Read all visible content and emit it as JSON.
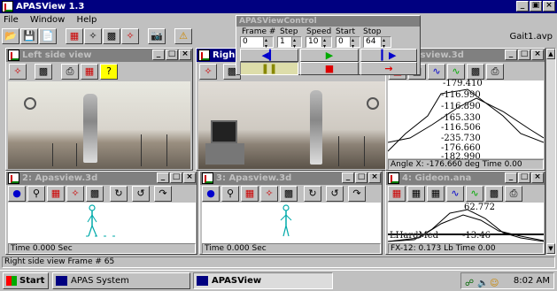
{
  "app": {
    "title": "APASView 1.3",
    "file_label": "Gait1.avp"
  },
  "menu": [
    "File",
    "Window",
    "Help"
  ],
  "control": {
    "title": "APASViewControl",
    "headers": [
      "Frame #",
      "Step",
      "Speed",
      "Start",
      "Stop"
    ],
    "values": [
      "0",
      "1",
      "10",
      "0",
      "64"
    ]
  },
  "windows": {
    "left": {
      "title": "Left  side view"
    },
    "right": {
      "title": "Righ"
    },
    "apas3d": {
      "title": "apasview.3d",
      "status": "Angle X: -176.660 deg Time 0.00",
      "values": [
        "-179.410",
        "-116.990",
        "-116.890",
        "-165.330",
        "-116.506",
        "-235.730",
        "-176.660",
        "-182.990"
      ]
    },
    "apas2": {
      "title": "2: Apasview.3d",
      "status": "Time 0.000 Sec"
    },
    "apas3": {
      "title": "3: Apasview.3d",
      "status": "Time 0.000 Sec"
    },
    "gideon": {
      "title": "4: Gideon.ana",
      "status": "FX-12: 0.173 Lb Time 0.00",
      "value": "62.772",
      "legend": "LHardMed",
      "value2": "-13.46"
    }
  },
  "statusbar": {
    "text": "Right side view Frame # 65"
  },
  "taskbar": {
    "start": "Start",
    "tasks": [
      "APAS System",
      "APASView"
    ],
    "clock": "8:02 AM"
  },
  "colors": {
    "titlebar": "#000080",
    "face": "#c0c0c0"
  }
}
